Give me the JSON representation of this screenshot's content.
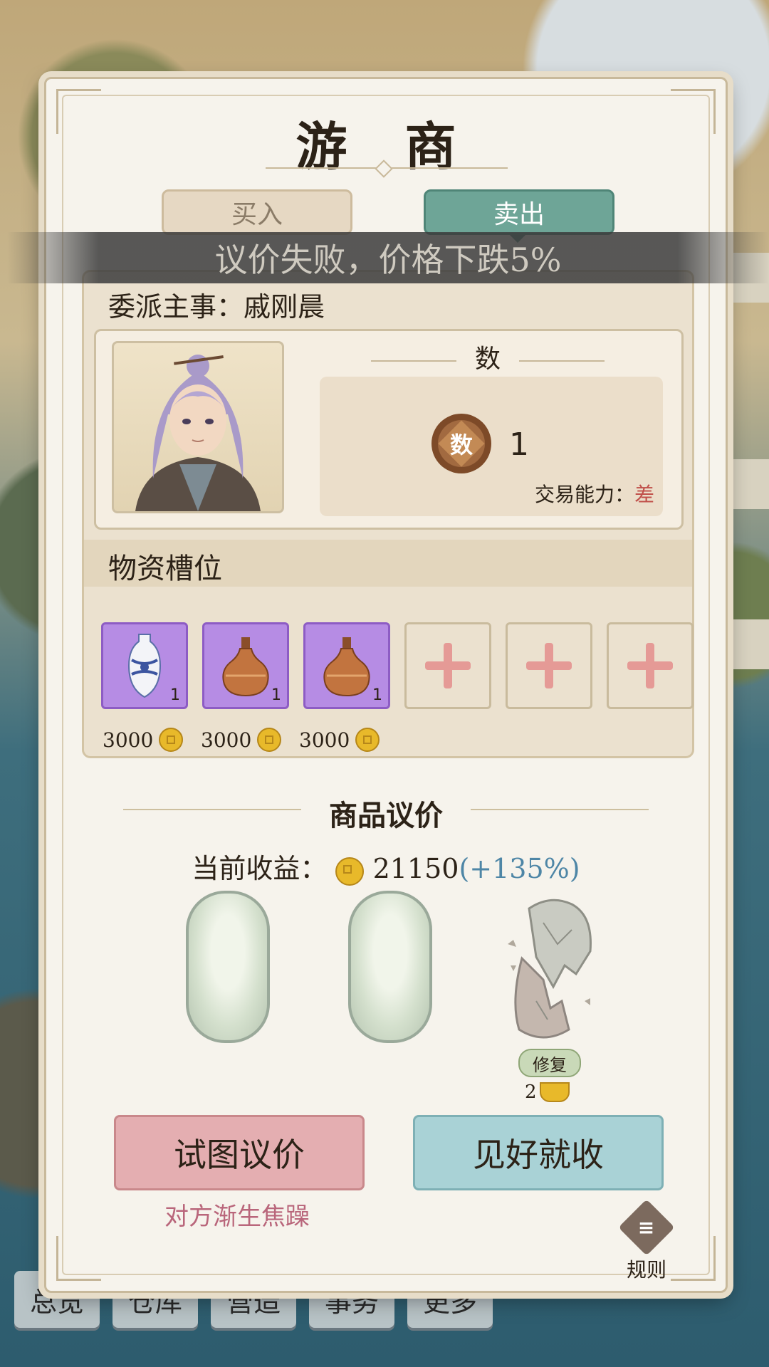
{
  "modal": {
    "title": "游 商",
    "tabs": {
      "buy": "买入",
      "sell": "卖出"
    },
    "toast": "议价失败，价格下跌5%",
    "assign": {
      "label": "委派主事：",
      "name": "戚刚晨"
    },
    "stat": {
      "header": "数",
      "badge": "数",
      "value": "1",
      "trade_label": "交易能力：",
      "trade_value": "差"
    },
    "slots": {
      "header": "物资槽位",
      "items": [
        {
          "icon": "vase-icon",
          "qty": "1",
          "price": "3000"
        },
        {
          "icon": "gourd-icon",
          "qty": "1",
          "price": "3000"
        },
        {
          "icon": "gourd-icon",
          "qty": "1",
          "price": "3000"
        }
      ],
      "empty_count": 3
    },
    "negotiation": {
      "title": "商品议价",
      "profit_label": "当前收益：",
      "profit_value": "21150",
      "profit_pct": "(+135%)",
      "stones": [
        "intact",
        "intact",
        "broken"
      ],
      "repair_label": "修复",
      "repair_cost": "2"
    },
    "buttons": {
      "negotiate": "试图议价",
      "negotiate_hint": "对方渐生焦躁",
      "accept": "见好就收"
    },
    "rules_label": "规则"
  },
  "bottom_nav": [
    "总览",
    "仓库",
    "营造",
    "事务",
    "更多"
  ],
  "colors": {
    "sell_tab": "#6ea597",
    "negotiate_btn": "#e4aeb1",
    "accept_btn": "#a9d2d6",
    "bad": "#c0504a",
    "slot_purple": "#b68ce4"
  }
}
